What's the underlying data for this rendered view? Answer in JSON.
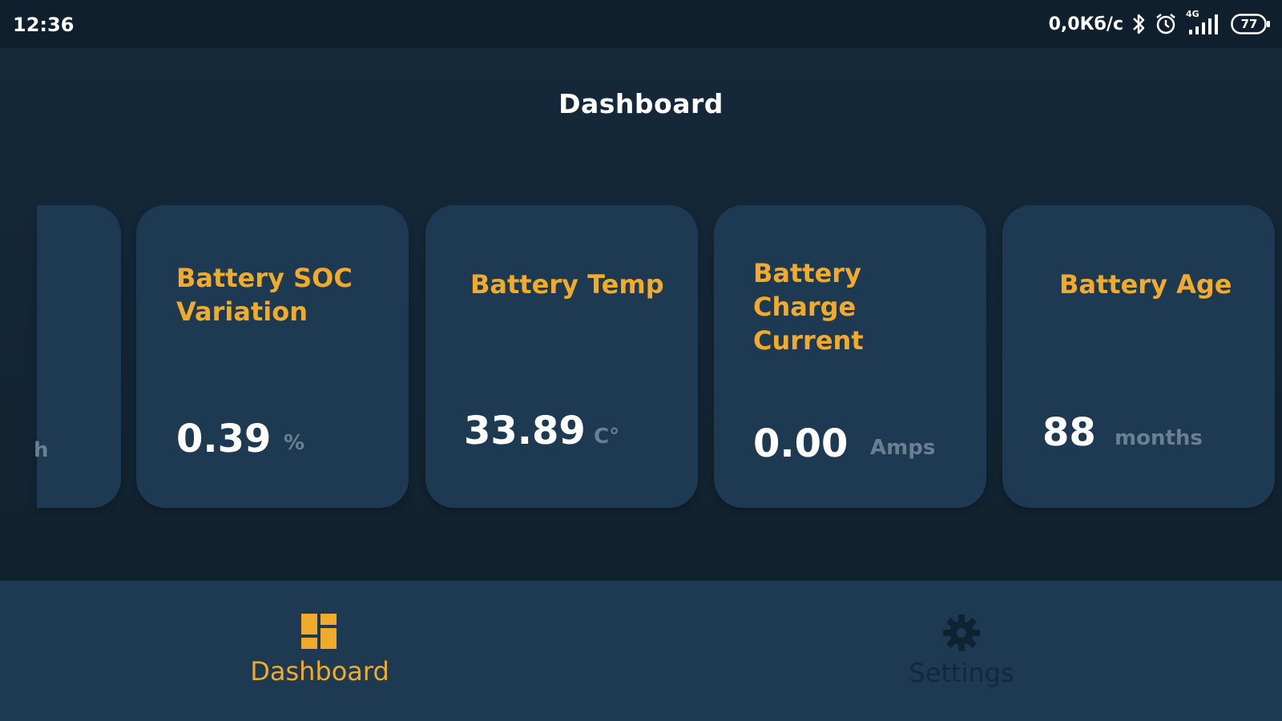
{
  "status_bar": {
    "time": "12:36",
    "network_speed": "0,0Кб/с",
    "signal_type": "4G",
    "battery_level": "77",
    "icons": [
      "bluetooth-icon",
      "alarm-icon",
      "signal-icon",
      "battery-icon"
    ]
  },
  "header": {
    "title": "Dashboard"
  },
  "cards": [
    {
      "title": "Battery SOC Variation",
      "value": "0.39",
      "unit": "%"
    },
    {
      "title": "Battery Temp",
      "value": "33.89",
      "unit": "C°"
    },
    {
      "title": "Battery Charge Current",
      "value": "0.00",
      "unit": "Amps"
    },
    {
      "title": "Battery Age",
      "value": "88",
      "unit": "months"
    }
  ],
  "partial_card": {
    "unit_fragment": "h"
  },
  "bottom_nav": {
    "items": [
      {
        "label": "Dashboard",
        "icon": "dashboard-grid-icon",
        "active": true
      },
      {
        "label": "Settings",
        "icon": "gear-icon",
        "active": false
      }
    ]
  },
  "colors": {
    "accent": "#f1ab2c",
    "card_bg": "#1d3a52",
    "page_bg": "#15293a",
    "unit_text": "#6a7f90"
  }
}
